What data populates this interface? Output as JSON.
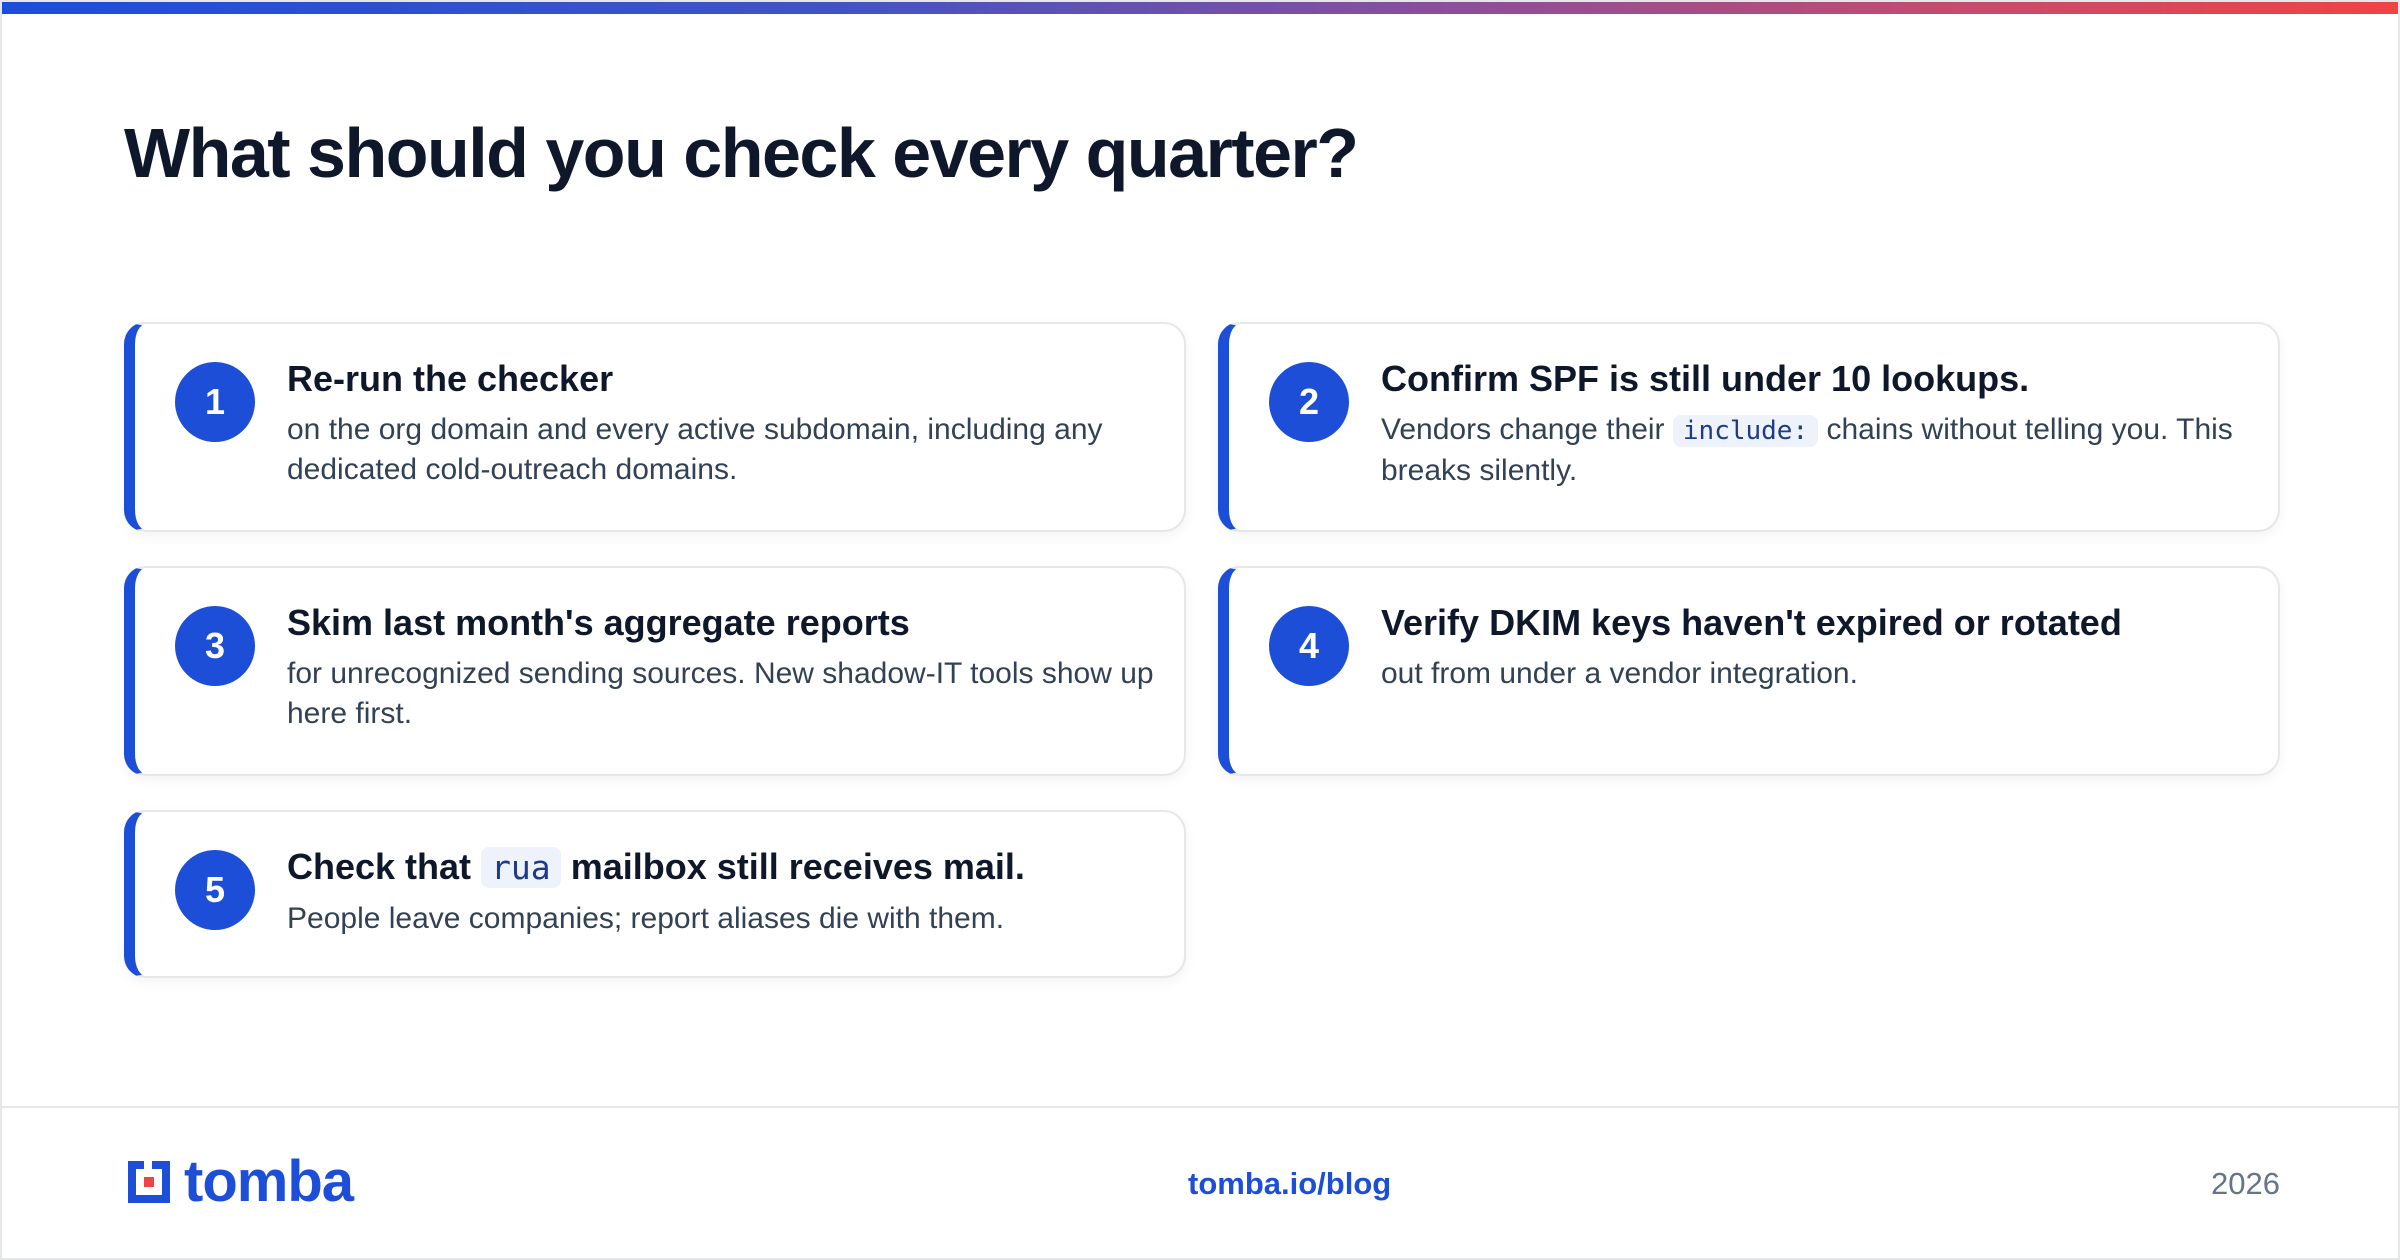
{
  "title": "What should you check every quarter?",
  "items": [
    {
      "number": "1",
      "title": "Re-run the checker",
      "desc": "on the org domain and every active subdomain, including any dedicated cold-outreach domains."
    },
    {
      "number": "2",
      "title": "Confirm SPF is still under 10 lookups.",
      "desc_before": "Vendors change their",
      "desc_code": "include:",
      "desc_after": "chains without telling you. This breaks silently."
    },
    {
      "number": "3",
      "title": "Skim last month's aggregate reports",
      "desc": "for unrecognized sending sources. New shadow-IT tools show up here first."
    },
    {
      "number": "4",
      "title": "Verify DKIM keys haven't expired or rotated",
      "desc": "out from under a vendor integration."
    },
    {
      "number": "5",
      "title_before": "Check that",
      "title_code": "rua",
      "title_after": "mailbox still receives mail.",
      "desc": "People leave companies; report aliases die with them."
    }
  ],
  "footer": {
    "logo_text": "tomba",
    "link": "tomba.io/blog",
    "year": "2026"
  },
  "colors": {
    "accent": "#1d4ed8",
    "title": "#0f172a",
    "body": "#334155",
    "muted": "#64748b"
  }
}
